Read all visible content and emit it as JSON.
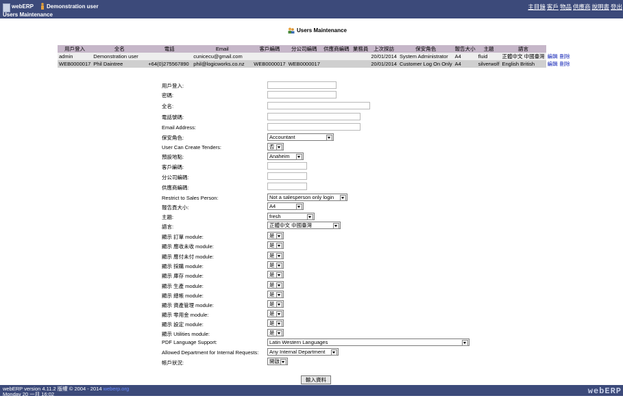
{
  "header": {
    "app_name": "webERP",
    "user_name": "Demonstration user",
    "page_name": "Users Maintenance",
    "menu": [
      "主目錄",
      "客戶",
      "物品",
      "供應商",
      "說明書",
      "登出"
    ]
  },
  "title": "Users Maintenance",
  "table": {
    "headers": [
      "用戶登入",
      "全名",
      "電話",
      "Email",
      "客戶編碼",
      "分公司編碼",
      "供應商編碼",
      "業務員",
      "上次探訪",
      "保安角色",
      "報告大小",
      "主題",
      "語言"
    ],
    "rows": [
      [
        "admin",
        "Demonstration user",
        "",
        "cunicecu@gmail.com",
        "",
        "",
        "",
        "",
        "20/01/2014",
        "System Administrator",
        "A4",
        "fluid",
        "正體中文 中國臺灣"
      ],
      [
        "WEB0000017",
        "Phil Daintree",
        "+64(0)275567890",
        "phil@logicworks.co.nz",
        "WEB0000017",
        "WEB0000017",
        "",
        "",
        "20/01/2014",
        "Customer Log On Only",
        "A4",
        "silverwolf",
        "English British"
      ]
    ],
    "edit_label": "編輯",
    "delete_label": "刪除"
  },
  "form": {
    "login_label": "用戶登入:",
    "password_label": "密碼:",
    "fullname_label": "全名:",
    "phone_label": "電話號碼:",
    "email_label": "Email Address:",
    "security_label": "保安角色:",
    "security_value": "Accountant",
    "tenders_label": "User Can Create Tenders:",
    "tenders_value": "否",
    "location_label": "預設地點:",
    "location_value": "Anaheim",
    "customer_label": "客戶編碼:",
    "branch_label": "分公司編碼:",
    "supplier_label": "供應商編碼:",
    "salesperson_label": "Restrict to Sales Person:",
    "salesperson_value": "Not a salesperson only login",
    "papersize_label": "報告頁大小:",
    "papersize_value": "A4",
    "theme_label": "主題:",
    "theme_value": "fresh",
    "language_label": "語言:",
    "language_value": "正體中文 中國臺灣",
    "modules": [
      {
        "label": "顯示 訂單 module:",
        "value": "是"
      },
      {
        "label": "顯示 應收未收 module:",
        "value": "是"
      },
      {
        "label": "顯示 應付未付 module:",
        "value": "是"
      },
      {
        "label": "顯示 採購 module:",
        "value": "是"
      },
      {
        "label": "顯示 庫存 module:",
        "value": "是"
      },
      {
        "label": "顯示 生產 module:",
        "value": "是"
      },
      {
        "label": "顯示 總帳 module:",
        "value": "是"
      },
      {
        "label": "顯示 資產管理 module:",
        "value": "是"
      },
      {
        "label": "顯示 零用金 module:",
        "value": "是"
      },
      {
        "label": "顯示 設定 module:",
        "value": "是"
      },
      {
        "label": "顯示 Utilities module:",
        "value": "是"
      }
    ],
    "pdf_label": "PDF Language Support:",
    "pdf_value": "Latin Western Languages",
    "department_label": "Allowed Department for Internal Requests:",
    "department_value": "Any Internal Department",
    "status_label": "帳戶狀況:",
    "status_value": "開啟",
    "submit_label": "輸入資料"
  },
  "footer": {
    "version": "webERP version 4.11.2 版權 © 2004 - 2014",
    "link": "weberp.org",
    "date": "Monday 20 一月 16:02",
    "logo": "webERP"
  },
  "colors": {
    "header_bg": "#3c4a7a",
    "table_header_bg": "#c6b7c9",
    "row_light": "#eeeeee",
    "row_dark": "#cfcfcf",
    "link": "#1a2bb8"
  }
}
